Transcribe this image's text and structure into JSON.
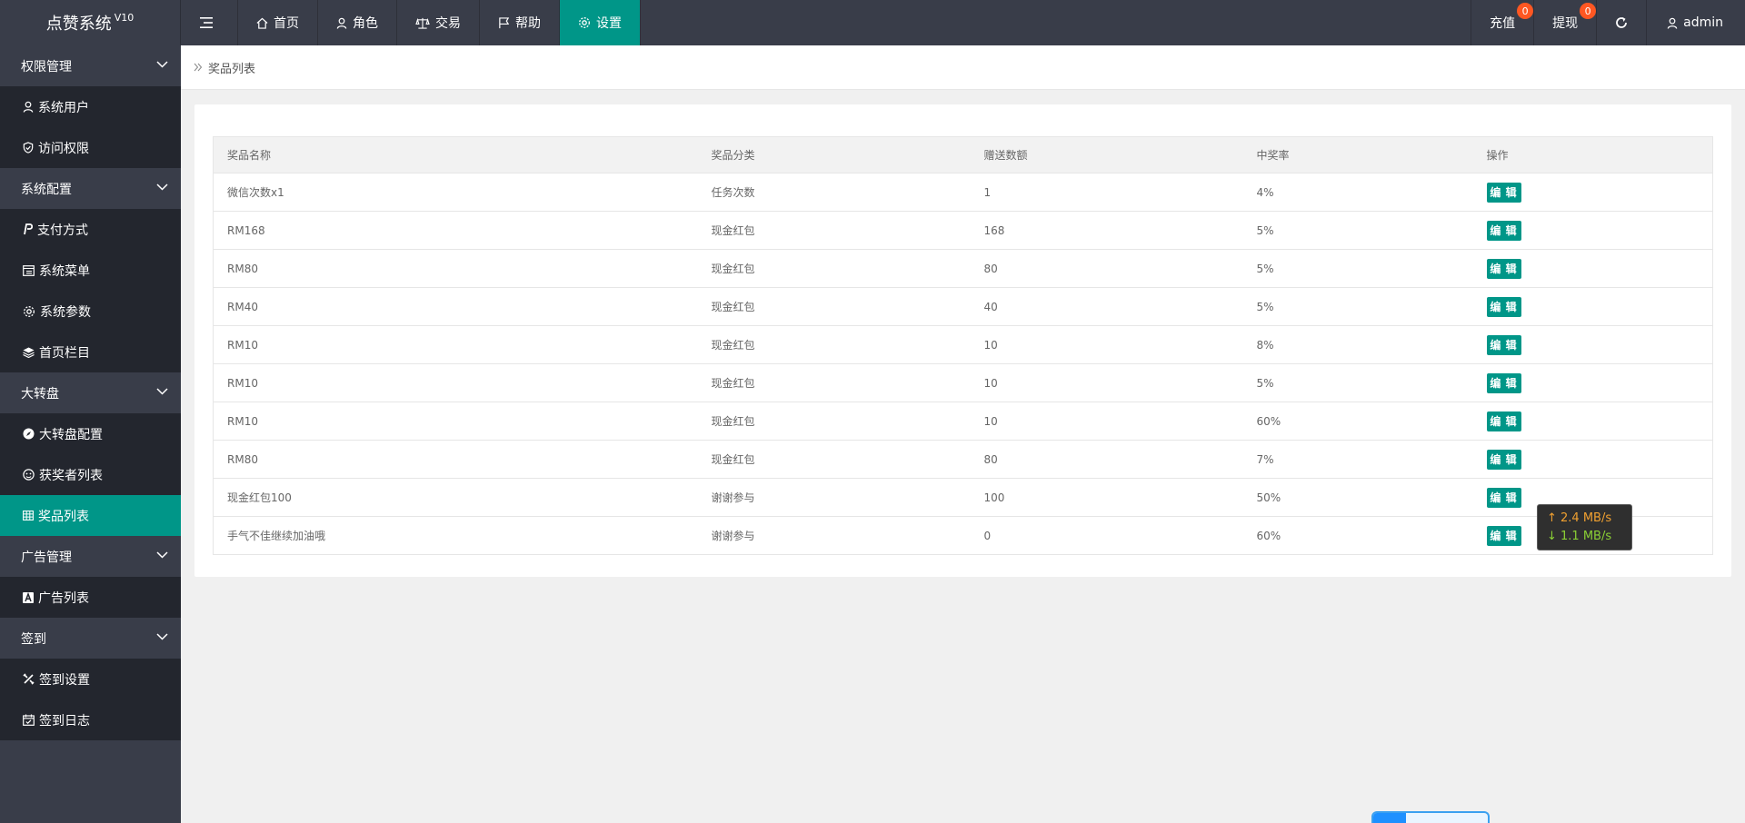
{
  "app": {
    "name": "点赞系统",
    "version": "V10"
  },
  "nav": [
    {
      "label": "首页",
      "icon": "home-icon"
    },
    {
      "label": "角色",
      "icon": "user-icon"
    },
    {
      "label": "交易",
      "icon": "scale-icon"
    },
    {
      "label": "帮助",
      "icon": "flag-icon"
    },
    {
      "label": "设置",
      "icon": "gear-icon",
      "active": true
    }
  ],
  "topright": {
    "recharge": {
      "label": "充值",
      "badge": "0"
    },
    "withdraw": {
      "label": "提现",
      "badge": "0"
    },
    "user": "admin"
  },
  "sidebar": {
    "groups": [
      {
        "label": "权限管理",
        "items": [
          {
            "label": "系统用户",
            "icon": "user-icon"
          },
          {
            "label": "访问权限",
            "icon": "shield-icon"
          }
        ]
      },
      {
        "label": "系统配置",
        "items": [
          {
            "label": "支付方式",
            "icon": "paypal-icon"
          },
          {
            "label": "系统菜单",
            "icon": "window-icon"
          },
          {
            "label": "系统参数",
            "icon": "gear-icon"
          },
          {
            "label": "首页栏目",
            "icon": "layers-icon"
          }
        ]
      },
      {
        "label": "大转盘",
        "items": [
          {
            "label": "大转盘配置",
            "icon": "compass-icon"
          },
          {
            "label": "获奖者列表",
            "icon": "face-icon"
          },
          {
            "label": "奖品列表",
            "icon": "grid-icon",
            "active": true
          }
        ]
      },
      {
        "label": "广告管理",
        "items": [
          {
            "label": "广告列表",
            "icon": "ad-icon"
          }
        ]
      },
      {
        "label": "签到",
        "items": [
          {
            "label": "签到设置",
            "icon": "tools-icon"
          },
          {
            "label": "签到日志",
            "icon": "calendar-icon"
          }
        ]
      }
    ]
  },
  "breadcrumb": "奖品列表",
  "table": {
    "headers": [
      "奖品名称",
      "奖品分类",
      "赠送数额",
      "中奖率",
      "操作"
    ],
    "edit_label": "编 辑",
    "rows": [
      [
        "微信次数x1",
        "任务次数",
        "1",
        "4%"
      ],
      [
        "RM168",
        "现金红包",
        "168",
        "5%"
      ],
      [
        "RM80",
        "现金红包",
        "80",
        "5%"
      ],
      [
        "RM40",
        "现金红包",
        "40",
        "5%"
      ],
      [
        "RM10",
        "现金红包",
        "10",
        "8%"
      ],
      [
        "RM10",
        "现金红包",
        "10",
        "5%"
      ],
      [
        "RM10",
        "现金红包",
        "10",
        "60%"
      ],
      [
        "RM80",
        "现金红包",
        "80",
        "7%"
      ],
      [
        "现金红包100",
        "谢谢参与",
        "100",
        "50%"
      ],
      [
        "手气不佳继续加油哦",
        "谢谢参与",
        "0",
        "60%"
      ]
    ]
  },
  "speed": {
    "up": "↑ 2.4 MB/s",
    "down": "↓ 1.1 MB/s"
  },
  "colors": {
    "accent": "#009688",
    "header": "#393d49",
    "sidebar_sub": "#23262e",
    "badge": "#ff5722"
  }
}
